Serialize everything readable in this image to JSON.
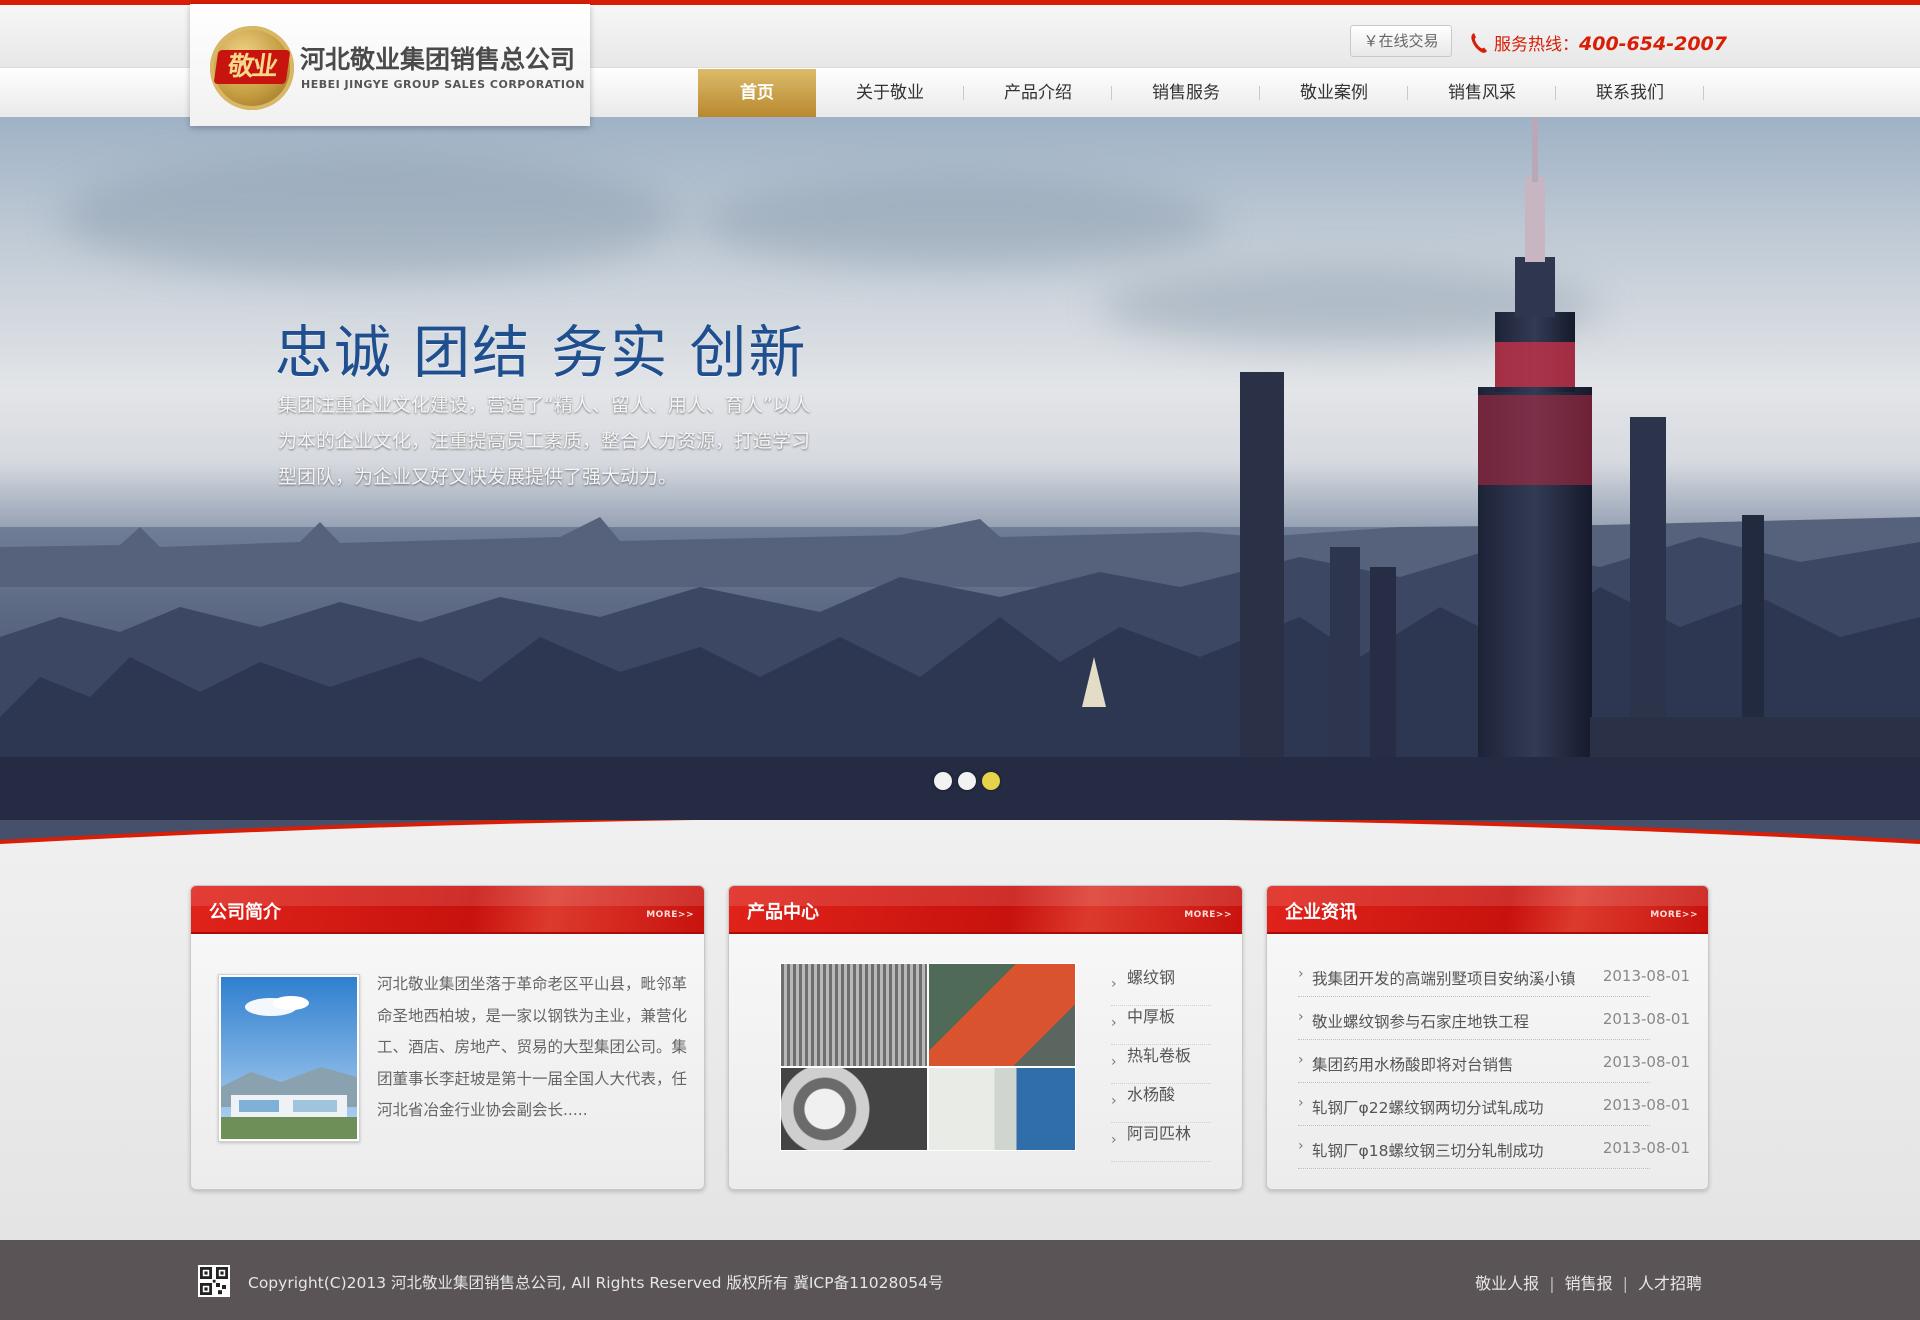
{
  "header": {
    "logo_mark": "敬业",
    "company_cn": "河北敬业集团销售总公司",
    "company_en": "HEBEI JINGYE GROUP SALES CORPORATION",
    "trade_button": "￥在线交易",
    "hotline_label": "服务热线：",
    "hotline_number": "400-654-2007"
  },
  "nav": {
    "items": [
      "首页",
      "关于敬业",
      "产品介绍",
      "销售服务",
      "敬业案例",
      "销售风采",
      "联系我们"
    ]
  },
  "banner": {
    "slogan": "忠诚 团结 务实 创新",
    "description": "集团注重企业文化建设，营造了“精人、留人、用人、育人”以人为本的企业文化，注重提高员工素质，整合人力资源，打造学习型团队，为企业又好又快发展提供了强大动力。",
    "slides_total": 3,
    "active_slide": 3
  },
  "panels": {
    "about": {
      "title": "公司简介",
      "more": "MORE>>",
      "text": "河北敬业集团坐落于革命老区平山县，毗邻革命圣地西柏坡，是一家以钢铁为主业，兼营化工、酒店、房地产、贸易的大型集团公司。集团董事长李赶坡是第十一届全国人大代表，任河北省冶金行业协会副会长....."
    },
    "products": {
      "title": "产品中心",
      "more": "MORE>>",
      "items": [
        "螺纹钢",
        "中厚板",
        "热轧卷板",
        "水杨酸",
        "阿司匹林"
      ]
    },
    "news": {
      "title": "企业资讯",
      "more": "MORE>>",
      "items": [
        {
          "title": "我集团开发的高端别墅项目安纳溪小镇",
          "date": "2013-08-01"
        },
        {
          "title": "敬业螺纹钢参与石家庄地铁工程",
          "date": "2013-08-01"
        },
        {
          "title": "集团药用水杨酸即将对台销售",
          "date": "2013-08-01"
        },
        {
          "title": "轧钢厂φ22螺纹钢两切分试轧成功",
          "date": "2013-08-01"
        },
        {
          "title": "轧钢厂φ18螺纹钢三切分轧制成功",
          "date": "2013-08-01"
        }
      ]
    }
  },
  "footer": {
    "copyright": "Copyright(C)2013 河北敬业集团销售总公司, All Rights Reserved 版权所有 冀ICP备11028054号",
    "links": [
      "敬业人报",
      "销售报",
      "人才招聘"
    ],
    "separator": "|"
  },
  "colors": {
    "brand_red": "#d81e06",
    "nav_active_gold": "#c9a24a",
    "footer_bg": "#5a5456"
  },
  "icons": [
    "phone-icon",
    "qr-code-icon",
    "chevron-right-icon"
  ]
}
